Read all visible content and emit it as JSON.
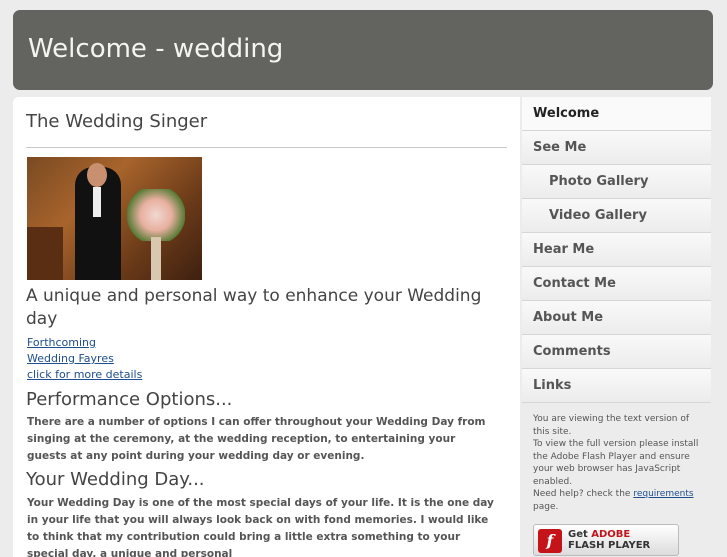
{
  "header": {
    "title": "Welcome - wedding"
  },
  "main": {
    "page_title": "The Wedding Singer",
    "tagline": "A unique and personal way to enhance your Wedding day",
    "links": [
      "Forthcoming",
      "Wedding Fayres",
      "click for more details"
    ],
    "performance_title": "Performance Options...",
    "performance_text": "There are a number of options I can offer throughout your Wedding Day from singing at the ceremony, at the wedding reception, to entertaining your guests at any point during your wedding day or evening.",
    "day_title": "Your Wedding Day...",
    "day_text": "Your Wedding Day is one of the most special days of your life. It is the one day in your life that you will always look back on with fond memories. I would like to think that my contribution could bring a little extra something to your special day, a unique and personal"
  },
  "sidebar": {
    "items": [
      {
        "label": "Welcome",
        "active": true,
        "sub": false
      },
      {
        "label": "See Me",
        "active": false,
        "sub": false
      },
      {
        "label": "Photo Gallery",
        "active": false,
        "sub": true
      },
      {
        "label": "Video Gallery",
        "active": false,
        "sub": true
      },
      {
        "label": "Hear Me",
        "active": false,
        "sub": false
      },
      {
        "label": "Contact Me",
        "active": false,
        "sub": false
      },
      {
        "label": "About Me",
        "active": false,
        "sub": false
      },
      {
        "label": "Comments",
        "active": false,
        "sub": false
      },
      {
        "label": "Links",
        "active": false,
        "sub": false
      }
    ],
    "notice": {
      "line1": "You are viewing the text version of this site.",
      "line2": "To view the full version please install the Adobe Flash Player and ensure your web browser has JavaScript enabled.",
      "help_prefix": "Need help? check the ",
      "help_link": "requirements",
      "help_suffix": " page."
    },
    "flash_badge": {
      "get": "Get ",
      "brand": "ADOBE",
      "product": "FLASH PLAYER",
      "icon": "flash-icon"
    }
  }
}
